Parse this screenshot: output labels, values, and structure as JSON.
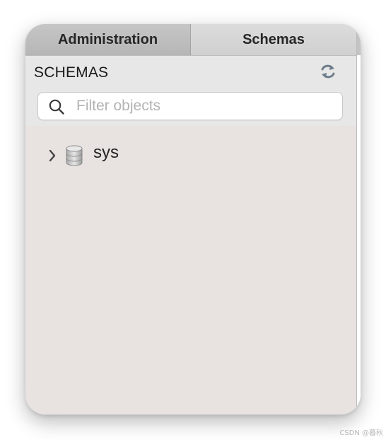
{
  "tabs": [
    {
      "label": "Administration",
      "active": false
    },
    {
      "label": "Schemas",
      "active": true
    }
  ],
  "header": {
    "title": "SCHEMAS",
    "refresh_icon": "refresh-icon"
  },
  "filter": {
    "value": "",
    "placeholder": "Filter objects",
    "icon": "search-icon"
  },
  "tree": {
    "items": [
      {
        "label": "sys",
        "icon": "database-icon",
        "expanded": false
      }
    ]
  },
  "watermark": "CSDN @暮秋",
  "colors": {
    "panel_bg": "#e8e3e1",
    "header_bg": "#e7e7e7",
    "tab_admin_bg": "#bdbdbd",
    "tab_schemas_bg": "#d6d6d6"
  }
}
